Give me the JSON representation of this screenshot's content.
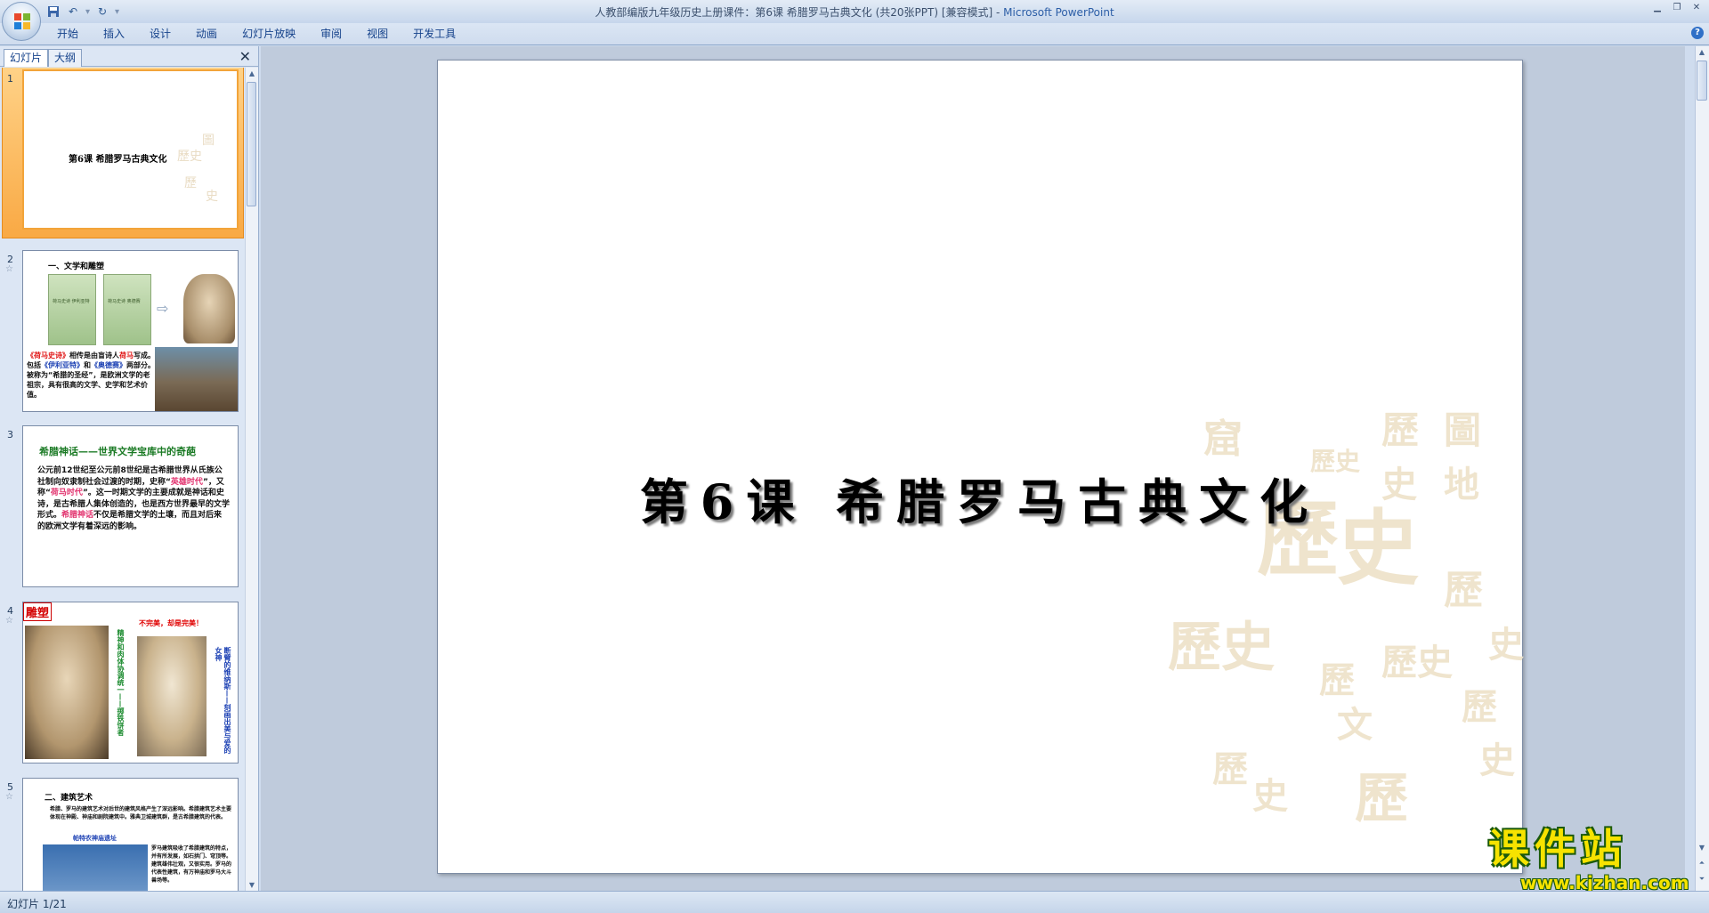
{
  "window": {
    "title": "人教部编版九年级历史上册课件：第6课  希腊罗马古典文化 (共20张PPT) [兼容模式]",
    "separator": " - ",
    "app_name": "Microsoft PowerPoint"
  },
  "ribbon": {
    "tabs": [
      "开始",
      "插入",
      "设计",
      "动画",
      "幻灯片放映",
      "审阅",
      "视图",
      "开发工具"
    ]
  },
  "left_panel": {
    "tabs": [
      "幻灯片",
      "大纲"
    ]
  },
  "slides": [
    {
      "number": "1",
      "title": "第6课  希腊罗马古典文化"
    },
    {
      "number": "2",
      "heading": "一、文学和雕塑",
      "book_labels": [
        "荷马史诗 伊利亚特",
        "荷马史诗 奥德赛"
      ],
      "text_parts": [
        "《荷马史诗》",
        "相传是由盲诗人",
        "荷马",
        "写成。包括",
        "《伊利亚特》",
        "和",
        "《奥德赛》",
        "两部分。被称为“希腊的圣经”，是欧洲文学的老祖宗，具有很高的文学、史学和艺术价值。"
      ]
    },
    {
      "number": "3",
      "heading": "希腊神话——世界文学宝库中的奇葩",
      "text_parts": [
        "公元前12世纪至公元前8世纪是古希腊世界从氏族公社制向奴隶制社会过渡的时期，史称“",
        "英雄时代",
        "”，又称“",
        "荷马时代",
        "”。这一时期文学的主要成就是神话和史诗，是古希腊人集体创造的，也是西方世界最早的文学形式。",
        "希腊神话",
        "不仅是希腊文学的土壤，而且对后来的欧洲文学有着深远的影响。"
      ]
    },
    {
      "number": "4",
      "label": "雕塑",
      "caption": "不完美，却是完美！",
      "vertical_left": "精神和肉体协调统一——掷铁饼者",
      "vertical_right": "断臂的维纳斯——刻画出美与爱的女神"
    },
    {
      "number": "5",
      "heading": "二、建筑艺术",
      "text": "希腊、罗马的建筑艺术对后世的建筑风格产生了深远影响。希腊建筑艺术主要体现在神殿、神庙和剧院建筑中。雅典卫城建筑群，是古希腊建筑的代表。",
      "sub_caption": "帕特农神庙遗址",
      "side_text": "罗马建筑吸收了希腊建筑的特点，并有所发展，如石拱门、穹顶等。建筑雄伟壮观，又很实用。罗马的代表性建筑，有万神庙和罗马大斗兽场等。"
    }
  ],
  "main_slide": {
    "title": "第6课    希腊罗马古典文化"
  },
  "watermark_logo": {
    "text": "课件站",
    "url": "www.kjzhan.com"
  },
  "status": {
    "slide_indicator": "幻灯片 1/21"
  },
  "colors": {
    "selected_thumb": "#f9a944",
    "title_link": "#2c5ea7",
    "logo_yellow": "#f6e300",
    "logo_green": "#1b5a0c"
  }
}
